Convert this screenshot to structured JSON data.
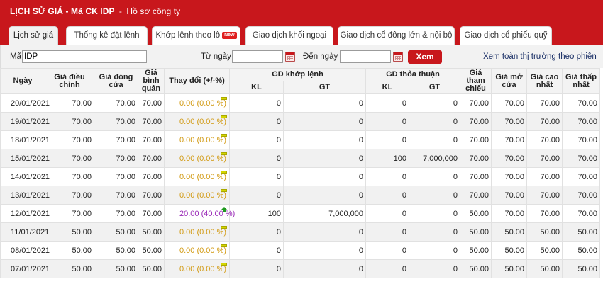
{
  "header": {
    "title": "LỊCH SỬ GIÁ - Mã CK IDP",
    "separator": "-",
    "profile_link": "Hồ sơ công ty"
  },
  "tabs": [
    {
      "label": "Lịch sử giá",
      "active": true
    },
    {
      "label": "Thống kê đặt lệnh",
      "active": false
    },
    {
      "label": "Khớp lệnh theo lô",
      "active": false,
      "badge": "New"
    },
    {
      "label": "Giao dịch khối ngoại",
      "active": false
    },
    {
      "label": "Giao dịch cổ đông lớn & nội bộ",
      "active": false
    },
    {
      "label": "Giao dịch cổ phiếu quỹ",
      "active": false
    }
  ],
  "search": {
    "symbol_label": "Mã",
    "symbol_value": "IDP",
    "from_label": "Từ ngày",
    "from_value": "",
    "to_label": "Đến ngày",
    "to_value": "",
    "submit_label": "Xem",
    "market_link": "Xem toàn thị trường theo phiên"
  },
  "table": {
    "headers": {
      "date": "Ngày",
      "adj_price": "Giá điều chỉnh",
      "close_price": "Giá đóng cửa",
      "avg_price": "Giá bình quân",
      "change": "Thay đổi (+/-%)",
      "matched_group": "GD khớp lệnh",
      "negotiated_group": "GD thỏa thuận",
      "kl": "KL",
      "gt": "GT",
      "ref_price": "Giá tham chiếu",
      "open_price": "Giá mở cửa",
      "high_price": "Giá cao nhất",
      "low_price": "Giá thấp nhất"
    },
    "colors": {
      "flat": "#d29a12",
      "up": "#9b2db8",
      "up_arrow": "#1e9a1e"
    },
    "rows": [
      {
        "date": "20/01/2021",
        "adj": "70.00",
        "close": "70.00",
        "avg": "70.00",
        "change": "0.00 (0.00 %)",
        "trend": "flat",
        "kl1": "0",
        "gt1": "0",
        "kl2": "0",
        "gt2": "0",
        "ref": "70.00",
        "open": "70.00",
        "high": "70.00",
        "low": "70.00"
      },
      {
        "date": "19/01/2021",
        "adj": "70.00",
        "close": "70.00",
        "avg": "70.00",
        "change": "0.00 (0.00 %)",
        "trend": "flat",
        "kl1": "0",
        "gt1": "0",
        "kl2": "0",
        "gt2": "0",
        "ref": "70.00",
        "open": "70.00",
        "high": "70.00",
        "low": "70.00"
      },
      {
        "date": "18/01/2021",
        "adj": "70.00",
        "close": "70.00",
        "avg": "70.00",
        "change": "0.00 (0.00 %)",
        "trend": "flat",
        "kl1": "0",
        "gt1": "0",
        "kl2": "0",
        "gt2": "0",
        "ref": "70.00",
        "open": "70.00",
        "high": "70.00",
        "low": "70.00"
      },
      {
        "date": "15/01/2021",
        "adj": "70.00",
        "close": "70.00",
        "avg": "70.00",
        "change": "0.00 (0.00 %)",
        "trend": "flat",
        "kl1": "0",
        "gt1": "0",
        "kl2": "100",
        "gt2": "7,000,000",
        "ref": "70.00",
        "open": "70.00",
        "high": "70.00",
        "low": "70.00"
      },
      {
        "date": "14/01/2021",
        "adj": "70.00",
        "close": "70.00",
        "avg": "70.00",
        "change": "0.00 (0.00 %)",
        "trend": "flat",
        "kl1": "0",
        "gt1": "0",
        "kl2": "0",
        "gt2": "0",
        "ref": "70.00",
        "open": "70.00",
        "high": "70.00",
        "low": "70.00"
      },
      {
        "date": "13/01/2021",
        "adj": "70.00",
        "close": "70.00",
        "avg": "70.00",
        "change": "0.00 (0.00 %)",
        "trend": "flat",
        "kl1": "0",
        "gt1": "0",
        "kl2": "0",
        "gt2": "0",
        "ref": "70.00",
        "open": "70.00",
        "high": "70.00",
        "low": "70.00"
      },
      {
        "date": "12/01/2021",
        "adj": "70.00",
        "close": "70.00",
        "avg": "70.00",
        "change": "20.00 (40.00 %)",
        "trend": "up",
        "kl1": "100",
        "gt1": "7,000,000",
        "kl2": "0",
        "gt2": "0",
        "ref": "50.00",
        "open": "70.00",
        "high": "70.00",
        "low": "70.00"
      },
      {
        "date": "11/01/2021",
        "adj": "50.00",
        "close": "50.00",
        "avg": "50.00",
        "change": "0.00 (0.00 %)",
        "trend": "flat",
        "kl1": "0",
        "gt1": "0",
        "kl2": "0",
        "gt2": "0",
        "ref": "50.00",
        "open": "50.00",
        "high": "50.00",
        "low": "50.00"
      },
      {
        "date": "08/01/2021",
        "adj": "50.00",
        "close": "50.00",
        "avg": "50.00",
        "change": "0.00 (0.00 %)",
        "trend": "flat",
        "kl1": "0",
        "gt1": "0",
        "kl2": "0",
        "gt2": "0",
        "ref": "50.00",
        "open": "50.00",
        "high": "50.00",
        "low": "50.00"
      },
      {
        "date": "07/01/2021",
        "adj": "50.00",
        "close": "50.00",
        "avg": "50.00",
        "change": "0.00 (0.00 %)",
        "trend": "flat",
        "kl1": "0",
        "gt1": "0",
        "kl2": "0",
        "gt2": "0",
        "ref": "50.00",
        "open": "50.00",
        "high": "50.00",
        "low": "50.00"
      }
    ]
  }
}
